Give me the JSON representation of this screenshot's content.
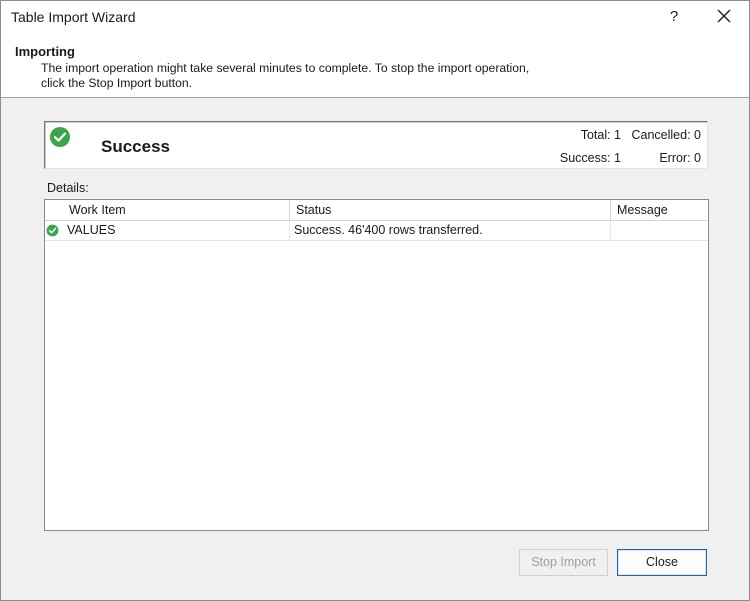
{
  "window": {
    "title": "Table Import Wizard",
    "help_label": "?"
  },
  "header": {
    "title": "Importing",
    "description": "The import operation might take several minutes to complete. To stop the import operation, click the Stop Import button."
  },
  "summary": {
    "status_title": "Success",
    "status_icon": "check-circle-icon",
    "status_color": "#3aa54a",
    "total_label": "Total: 1",
    "cancelled_label": "Cancelled: 0",
    "success_label": "Success: 1",
    "error_label": "Error: 0"
  },
  "details": {
    "label": "Details:",
    "columns": [
      "Work Item",
      "Status",
      "Message"
    ],
    "rows": [
      {
        "icon": "check-circle-icon",
        "work_item": "VALUES",
        "status": "Success. 46'400 rows transferred.",
        "message": ""
      }
    ]
  },
  "buttons": {
    "stop_import": "Stop Import",
    "close": "Close"
  },
  "colors": {
    "accent": "#1a64c8",
    "success": "#3aa54a"
  }
}
